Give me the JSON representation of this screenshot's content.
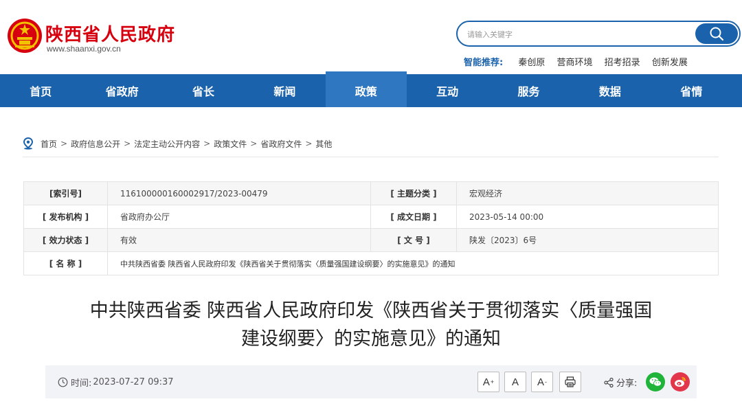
{
  "header": {
    "site_name": "陕西省人民政府",
    "site_url": "www.shaanxi.gov.cn",
    "search_placeholder": "请输入关键字",
    "hot_label": "智能推荐:",
    "hot_links": [
      "秦创原",
      "营商环境",
      "招考招录",
      "创新发展"
    ]
  },
  "nav": [
    "首页",
    "省政府",
    "省长",
    "新闻",
    "政策",
    "互动",
    "服务",
    "数据",
    "省情"
  ],
  "nav_active_index": 4,
  "breadcrumb": {
    "items": [
      "首页",
      "政府信息公开",
      "法定主动公开内容",
      "政策文件",
      "省政府文件",
      "其他"
    ],
    "separator": ">"
  },
  "info": {
    "index_label": "[索引号]",
    "index_value": "116100000160002917/2023-00479",
    "topic_label": "[ 主题分类 ]",
    "topic_value": "宏观经济",
    "issuer_label": "[ 发布机构 ]",
    "issuer_value": "省政府办公厅",
    "date_label": "[ 成文日期 ]",
    "date_value": "2023-05-14 00:00",
    "status_label": "[ 效力状态 ]",
    "status_value": "有效",
    "docno_label": "[ 文 号 ]",
    "docno_value": "陕发〔2023〕6号",
    "name_label": "[ 名 称 ]",
    "name_value": "中共陕西省委 陕西省人民政府印发《陕西省关于贯彻落实〈质量强国建设纲要〉的实施意见》的通知"
  },
  "article": {
    "title_line1": "中共陕西省委 陕西省人民政府印发《陕西省关于贯彻落实〈质量强国",
    "title_line2": "建设纲要〉的实施意见》的通知",
    "time_label": "时间:",
    "time_value": "2023-07-27 09:37",
    "font_large": "A",
    "font_large_sup": "+",
    "font_normal": "A",
    "font_small": "A",
    "font_small_sup": "-",
    "share_label": "分享:"
  },
  "colors": {
    "brand_red": "#d6000f",
    "nav_blue": "#1a62ab",
    "nav_active": "#2f78c1",
    "wechat_green": "#21b43a",
    "weibo_red": "#e2374b"
  }
}
